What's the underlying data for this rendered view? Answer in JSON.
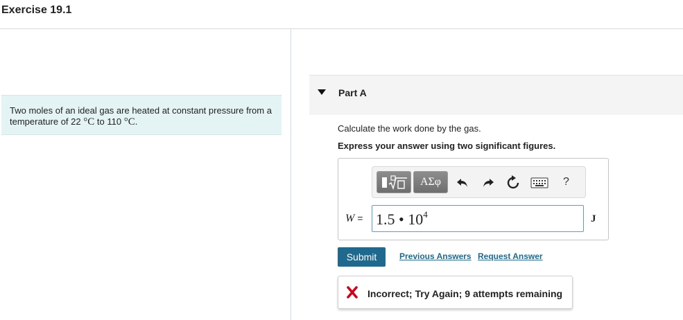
{
  "exercise": {
    "title": "Exercise 19.1"
  },
  "problem": {
    "text_before": "Two moles of an ideal gas are heated at constant pressure from a temperature of 22",
    "unit": "°C",
    "to_word": "to",
    "value2": "110",
    "end": "."
  },
  "part": {
    "label": "Part A"
  },
  "question": {
    "text": "Calculate the work done by the gas.",
    "instruction": "Express your answer using two significant figures."
  },
  "toolbar": {
    "greek_label": "ΑΣφ",
    "help_label": "?",
    "icons": [
      "templates-icon",
      "greek-letters-icon",
      "undo-icon",
      "redo-icon",
      "reset-icon",
      "keyboard-icon",
      "help-icon"
    ]
  },
  "answer": {
    "variable": "W",
    "equals": "=",
    "mantissa": "1.5 • 10",
    "exponent": "4",
    "unit": "J"
  },
  "actions": {
    "submit": "Submit",
    "previous_answers": "Previous Answers",
    "request_answer": "Request Answer"
  },
  "feedback": {
    "text": "Incorrect; Try Again; 9 attempts remaining",
    "icon": "x-icon",
    "color": "#d0021b"
  }
}
